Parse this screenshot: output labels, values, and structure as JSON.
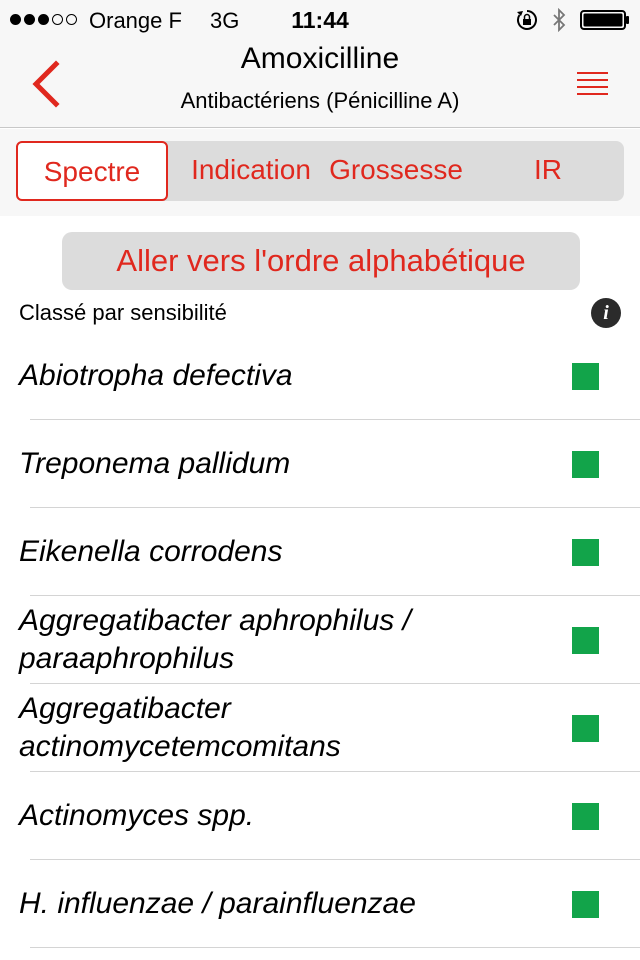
{
  "status_bar": {
    "signal_filled": 3,
    "signal_empty": 2,
    "carrier": "Orange F",
    "network": "3G",
    "time": "11:44"
  },
  "header": {
    "title": "Amoxicilline",
    "subtitle": "Antibactériens (Pénicilline A)"
  },
  "tabs": [
    {
      "label": "Spectre",
      "selected": true
    },
    {
      "label": "Indication",
      "selected": false
    },
    {
      "label": "Grossesse",
      "selected": false
    },
    {
      "label": "IR",
      "selected": false
    }
  ],
  "alphabetical_button": "Aller vers l'ordre alphabétique",
  "sort_label": "Classé par sensibilité",
  "organisms": [
    {
      "name": "Abiotropha defectiva",
      "status_color": "#12a44a"
    },
    {
      "name": "Treponema pallidum",
      "status_color": "#12a44a"
    },
    {
      "name": "Eikenella corrodens",
      "status_color": "#12a44a"
    },
    {
      "name": "Aggregatibacter aphrophilus / paraaphrophilus",
      "status_color": "#12a44a"
    },
    {
      "name": "Aggregatibacter actinomycetemcomitans",
      "status_color": "#12a44a"
    },
    {
      "name": "Actinomyces spp.",
      "status_color": "#12a44a"
    },
    {
      "name": "H. influenzae / parainfluenzae",
      "status_color": "#12a44a"
    }
  ],
  "colors": {
    "accent": "#e0281e",
    "sensitive": "#12a44a",
    "bar_background": "#f7f7f7",
    "segment_background": "#dcdcdc"
  },
  "icons": {
    "back": "chevron-left-icon",
    "menu": "menu-lines-icon",
    "info": "info-icon",
    "rotation_lock": "rotation-lock-icon",
    "bluetooth": "bluetooth-icon",
    "battery": "battery-icon"
  }
}
